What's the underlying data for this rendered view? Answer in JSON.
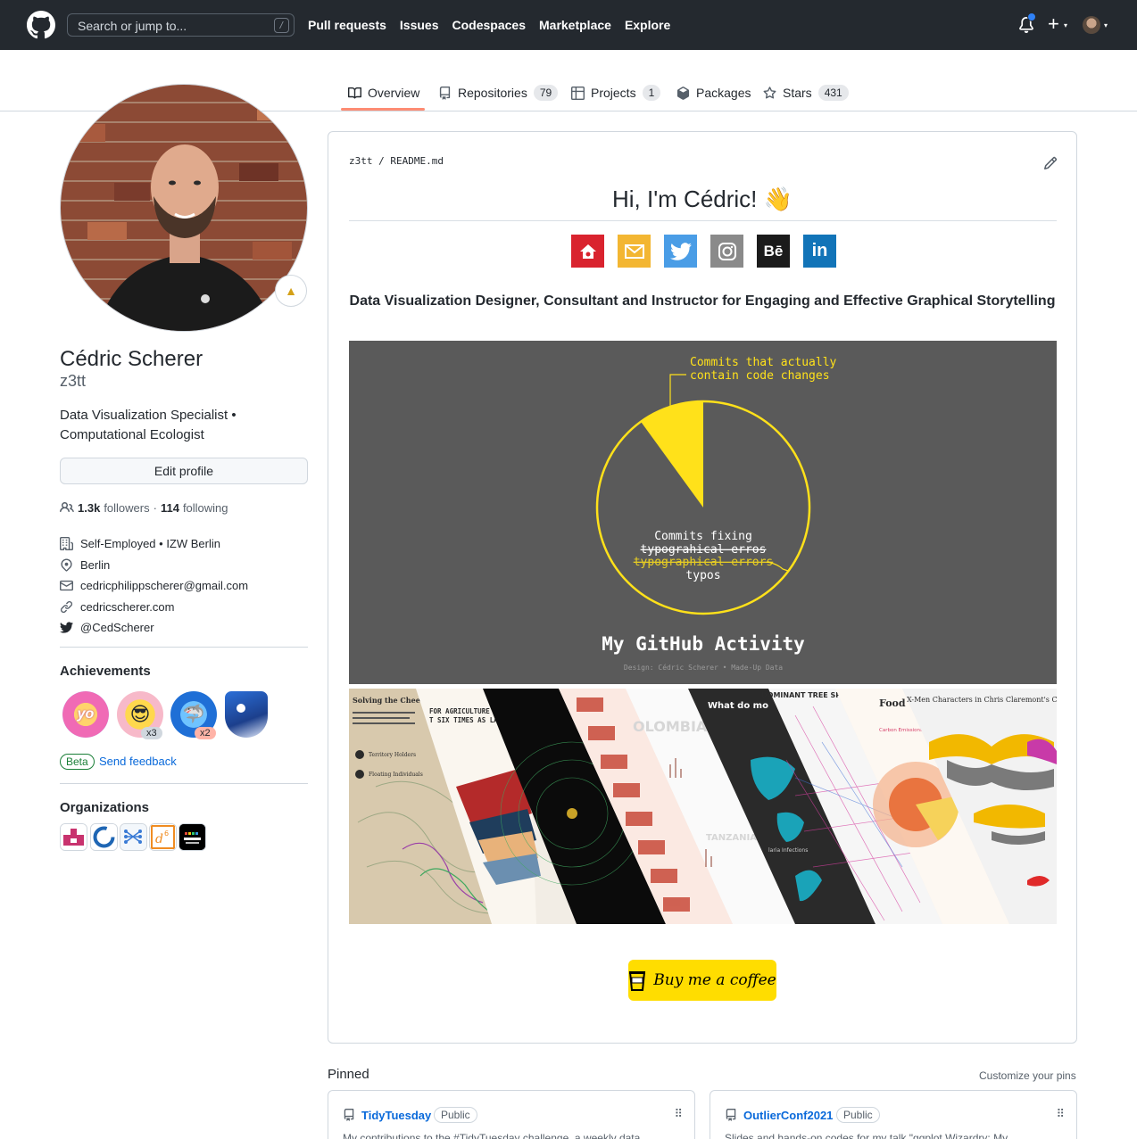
{
  "header": {
    "search_placeholder": "Search or jump to...",
    "search_shortcut": "/",
    "nav": [
      "Pull requests",
      "Issues",
      "Codespaces",
      "Marketplace",
      "Explore"
    ],
    "plus": "+",
    "caret": "▾"
  },
  "tabs": [
    {
      "label": "Overview",
      "count": null,
      "icon": "book-icon",
      "active": true
    },
    {
      "label": "Repositories",
      "count": "79",
      "icon": "repo-icon"
    },
    {
      "label": "Projects",
      "count": "1",
      "icon": "table-icon"
    },
    {
      "label": "Packages",
      "count": null,
      "icon": "package-icon"
    },
    {
      "label": "Stars",
      "count": "431",
      "icon": "star-icon"
    }
  ],
  "profile": {
    "name": "Cédric Scherer",
    "login": "z3tt",
    "bio": "Data Visualization Specialist • Computational Ecologist",
    "edit_label": "Edit profile",
    "followers_count": "1.3k",
    "followers_label": "followers",
    "dot": "·",
    "following_count": "114",
    "following_label": "following",
    "details": [
      {
        "icon": "building-icon",
        "text": "Self-Employed • IZW Berlin"
      },
      {
        "icon": "location-icon",
        "text": "Berlin"
      },
      {
        "icon": "mail-icon",
        "text": "cedricphilippscherer@gmail.com"
      },
      {
        "icon": "link-icon",
        "text": "cedricscherer.com"
      },
      {
        "icon": "twitter-icon",
        "text": "@CedScherer"
      }
    ]
  },
  "achievements": {
    "title": "Achievements",
    "badges": [
      {
        "name": "yolo",
        "count": null
      },
      {
        "name": "quickdraw",
        "count": "x3"
      },
      {
        "name": "pull-shark",
        "count": "x2"
      },
      {
        "name": "arctic-code-vault",
        "count": null
      }
    ],
    "beta": "Beta",
    "feedback": "Send feedback"
  },
  "organizations": {
    "title": "Organizations",
    "count": 5
  },
  "readme": {
    "breadcrumb_user": "z3tt",
    "breadcrumb_sep": "/",
    "breadcrumb_file": "README.md",
    "heading": "Hi, I'm Cédric! 👋",
    "socials": [
      {
        "name": "website",
        "color": "#d9232e"
      },
      {
        "name": "email",
        "color": "#f3b632"
      },
      {
        "name": "twitter",
        "color": "#4a9de6"
      },
      {
        "name": "instagram",
        "color": "#8a8a8a"
      },
      {
        "name": "behance",
        "color": "#1b1b1b"
      },
      {
        "name": "linkedin",
        "color": "#1274b8"
      }
    ],
    "tagline": "Data Visualization Designer, Consultant and Instructor for Engaging and Effective Graphical Storytelling",
    "activity": {
      "callout_top_line1": "Commits that actually",
      "callout_top_line2": "contain code changes",
      "inner_line1": "Commits fixing",
      "inner_line2": "typograhical erros",
      "inner_line3": "typographical errors",
      "inner_line4": "typos",
      "title": "My GitHub Activity",
      "caption": "Design: Cédric Scherer • Made-Up Data",
      "slice_fraction": 0.1
    },
    "collage": {
      "p1_title": "Solving the Cheetah-Fa",
      "p1_legend1": "Territory Holders",
      "p1_legend2": "Floating Individuals",
      "p2_title": "FOR AGRICULTURE COVERED",
      "p2_sub": "T SIX TIMES AS LARGE AS",
      "p5_title": "OLOMBIA",
      "p5_country": "TANZANIA",
      "p6_title": "What do mo",
      "p6_label": "laria Infections",
      "p7_title": "DOMINANT TREE SPECIES",
      "p8_title": "Food",
      "p8_sub": "Carbon Emissions",
      "p9_title": "X-Men Characters in Chris Claremont's Comics"
    },
    "bmc_label": "Buy me a coffee"
  },
  "pinned": {
    "title": "Pinned",
    "customize": "Customize your pins",
    "repos": [
      {
        "name": "TidyTuesday",
        "visibility": "Public",
        "desc": "My contributions to the #TidyTuesday challenge, a weekly data"
      },
      {
        "name": "OutlierConf2021",
        "visibility": "Public",
        "desc": "Slides and hands-on codes for my talk \"ggplot Wizardry: My"
      }
    ]
  }
}
